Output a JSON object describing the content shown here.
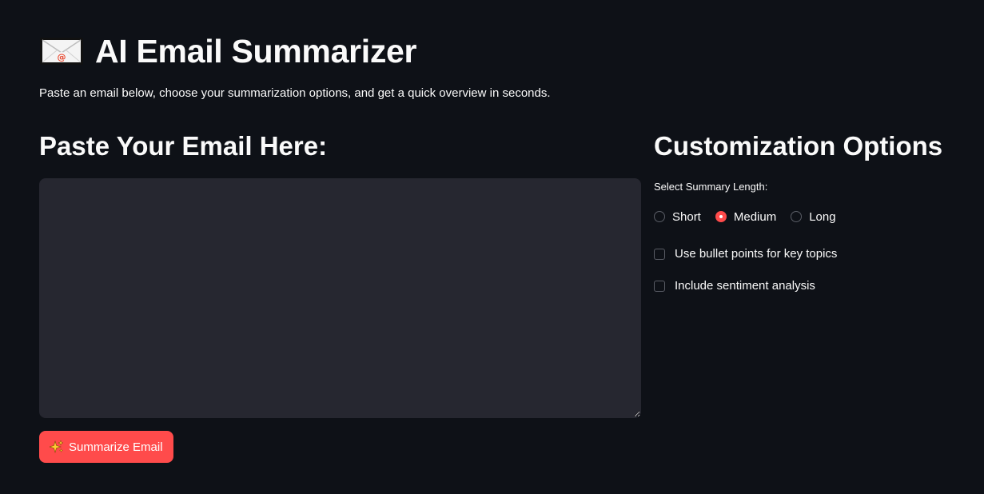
{
  "header": {
    "icon": "incoming-envelope-icon",
    "title": "AI Email Summarizer",
    "subtitle": "Paste an email below, choose your summarization options, and get a quick overview in seconds."
  },
  "email_section": {
    "heading": "Paste Your Email Here:",
    "input_value": "",
    "input_placeholder": ""
  },
  "summarize_button": {
    "icon": "sparkles-icon",
    "label": "Summarize Email",
    "color": "#ff4b4b"
  },
  "options": {
    "heading": "Customization Options",
    "length_label": "Select Summary Length:",
    "length_options": [
      {
        "label": "Short",
        "selected": false
      },
      {
        "label": "Medium",
        "selected": true
      },
      {
        "label": "Long",
        "selected": false
      }
    ],
    "checkboxes": [
      {
        "label": "Use bullet points for key topics",
        "checked": false
      },
      {
        "label": "Include sentiment analysis",
        "checked": false
      }
    ]
  },
  "colors": {
    "background": "#0e1117",
    "input_background": "#262730",
    "accent": "#ff4b4b",
    "text": "#fafafa"
  }
}
